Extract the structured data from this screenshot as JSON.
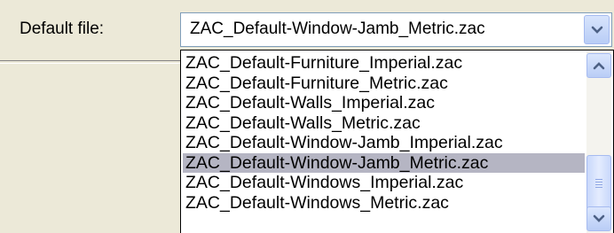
{
  "field": {
    "label": "Default file:",
    "selected_value": "ZAC_Default-Window-Jamb_Metric.zac"
  },
  "dropdown": {
    "items": [
      "ZAC_Default-Furniture_Imperial.zac",
      "ZAC_Default-Furniture_Metric.zac",
      "ZAC_Default-Walls_Imperial.zac",
      "ZAC_Default-Walls_Metric.zac",
      "ZAC_Default-Window-Jamb_Imperial.zac",
      "ZAC_Default-Window-Jamb_Metric.zac",
      "ZAC_Default-Windows_Imperial.zac",
      "ZAC_Default-Windows_Metric.zac"
    ],
    "selected_index": 5
  },
  "icons": {
    "combo_arrow": "chevron-down-icon",
    "scroll_up": "chevron-up-icon",
    "scroll_down": "chevron-down-icon",
    "thumb_grip": "grip-icon"
  },
  "colors": {
    "window_bg": "#ece9d8",
    "selection": "#b5b5c3",
    "combo_border": "#7f9db9",
    "arrow": "#4d6185"
  }
}
